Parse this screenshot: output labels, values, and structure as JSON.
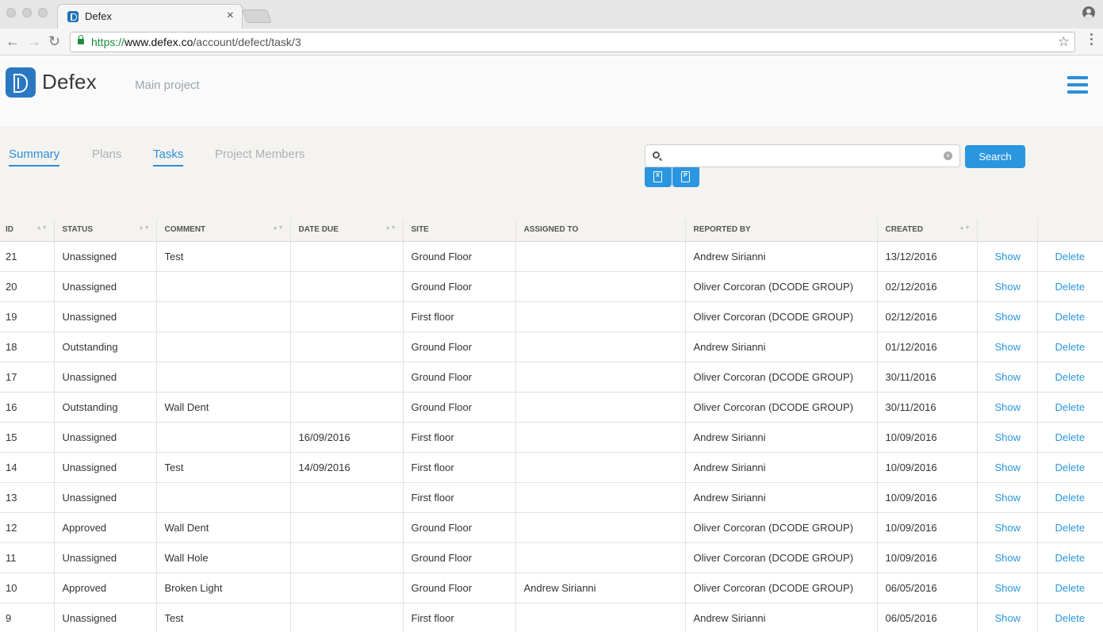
{
  "browser": {
    "tab_title": "Defex",
    "tab_close": "×",
    "url_scheme": "https://",
    "url_host": "www.defex.co",
    "url_path": "/account/defect/task/3",
    "back_glyph": "←",
    "forward_glyph": "→",
    "reload_glyph": "↻",
    "star_glyph": "☆"
  },
  "header": {
    "logo_text": "Defex",
    "project_name": "Main project"
  },
  "nav": {
    "tabs": [
      {
        "label": "Summary"
      },
      {
        "label": "Plans"
      },
      {
        "label": "Tasks"
      },
      {
        "label": "Project Members"
      }
    ]
  },
  "search": {
    "placeholder": "",
    "value": "",
    "clear": "×",
    "button_label": "Search"
  },
  "exports": {
    "excel_glyph": "X",
    "pdf_glyph": "P"
  },
  "table": {
    "columns": [
      "ID",
      "STATUS",
      "COMMENT",
      "DATE DUE",
      "SITE",
      "ASSIGNED TO",
      "REPORTED BY",
      "CREATED",
      "",
      ""
    ],
    "sort_glyph": "▲▼",
    "rows": [
      {
        "id": "21",
        "status": "Unassigned",
        "comment": "Test",
        "due": "",
        "site": "Ground Floor",
        "assigned": "",
        "reported": "Andrew Sirianni",
        "created": "13/12/2016",
        "show": "Show",
        "delete": "Delete"
      },
      {
        "id": "20",
        "status": "Unassigned",
        "comment": "",
        "due": "",
        "site": "Ground Floor",
        "assigned": "",
        "reported": "Oliver Corcoran (DCODE GROUP)",
        "created": "02/12/2016",
        "show": "Show",
        "delete": "Delete"
      },
      {
        "id": "19",
        "status": "Unassigned",
        "comment": "",
        "due": "",
        "site": "First floor",
        "assigned": "",
        "reported": "Oliver Corcoran (DCODE GROUP)",
        "created": "02/12/2016",
        "show": "Show",
        "delete": "Delete"
      },
      {
        "id": "18",
        "status": "Outstanding",
        "comment": "",
        "due": "",
        "site": "Ground Floor",
        "assigned": "",
        "reported": "Andrew Sirianni",
        "created": "01/12/2016",
        "show": "Show",
        "delete": "Delete"
      },
      {
        "id": "17",
        "status": "Unassigned",
        "comment": "",
        "due": "",
        "site": "Ground Floor",
        "assigned": "",
        "reported": "Oliver Corcoran (DCODE GROUP)",
        "created": "30/11/2016",
        "show": "Show",
        "delete": "Delete"
      },
      {
        "id": "16",
        "status": "Outstanding",
        "comment": "Wall Dent",
        "due": "",
        "site": "Ground Floor",
        "assigned": "",
        "reported": "Oliver Corcoran (DCODE GROUP)",
        "created": "30/11/2016",
        "show": "Show",
        "delete": "Delete"
      },
      {
        "id": "15",
        "status": "Unassigned",
        "comment": "",
        "due": "16/09/2016",
        "site": "First floor",
        "assigned": "",
        "reported": "Andrew Sirianni",
        "created": "10/09/2016",
        "show": "Show",
        "delete": "Delete"
      },
      {
        "id": "14",
        "status": "Unassigned",
        "comment": "Test",
        "due": "14/09/2016",
        "site": "First floor",
        "assigned": "",
        "reported": "Andrew Sirianni",
        "created": "10/09/2016",
        "show": "Show",
        "delete": "Delete"
      },
      {
        "id": "13",
        "status": "Unassigned",
        "comment": "",
        "due": "",
        "site": "First floor",
        "assigned": "",
        "reported": "Andrew Sirianni",
        "created": "10/09/2016",
        "show": "Show",
        "delete": "Delete"
      },
      {
        "id": "12",
        "status": "Approved",
        "comment": "Wall Dent",
        "due": "",
        "site": "Ground Floor",
        "assigned": "",
        "reported": "Oliver Corcoran (DCODE GROUP)",
        "created": "10/09/2016",
        "show": "Show",
        "delete": "Delete"
      },
      {
        "id": "11",
        "status": "Unassigned",
        "comment": "Wall Hole",
        "due": "",
        "site": "Ground Floor",
        "assigned": "",
        "reported": "Oliver Corcoran (DCODE GROUP)",
        "created": "10/09/2016",
        "show": "Show",
        "delete": "Delete"
      },
      {
        "id": "10",
        "status": "Approved",
        "comment": "Broken Light",
        "due": "",
        "site": "Ground Floor",
        "assigned": "Andrew Sirianni",
        "reported": "Oliver Corcoran (DCODE GROUP)",
        "created": "06/05/2016",
        "show": "Show",
        "delete": "Delete"
      },
      {
        "id": "9",
        "status": "Unassigned",
        "comment": "Test",
        "due": "",
        "site": "First floor",
        "assigned": "",
        "reported": "Andrew Sirianni",
        "created": "06/05/2016",
        "show": "Show",
        "delete": "Delete"
      }
    ]
  }
}
